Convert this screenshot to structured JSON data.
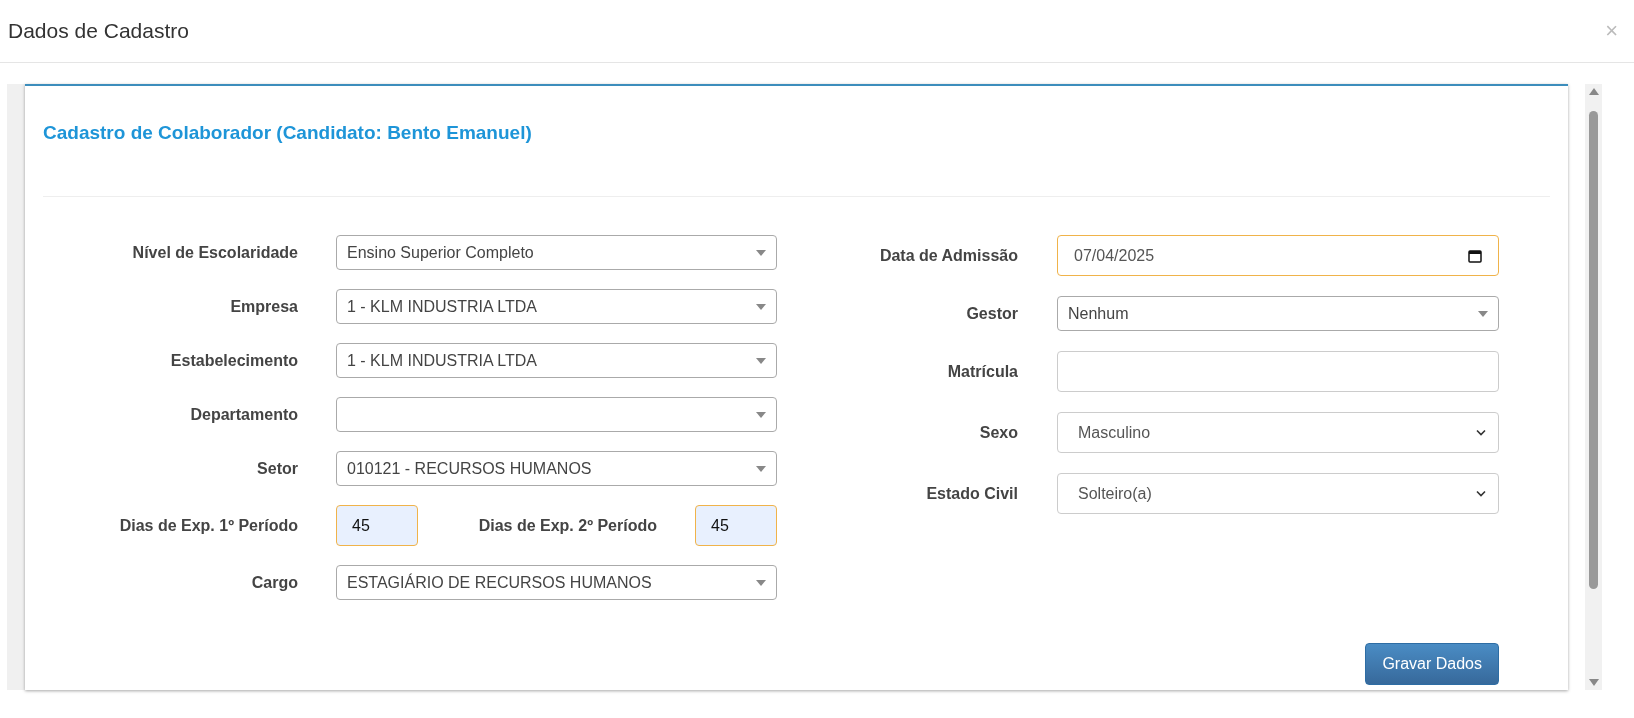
{
  "dialog": {
    "title": "Dados de Cadastro",
    "close": "×"
  },
  "form": {
    "title": "Cadastro de Colaborador (Candidato: Bento Emanuel)",
    "left_fields": [
      {
        "kind": "select",
        "label": "Nível de Escolaridade",
        "value": "Ensino Superior Completo"
      },
      {
        "kind": "select",
        "label": "Empresa",
        "value": "1 - KLM INDUSTRIA LTDA"
      },
      {
        "kind": "select",
        "label": "Estabelecimento",
        "value": "1 - KLM INDUSTRIA LTDA"
      },
      {
        "kind": "select",
        "label": "Departamento"
      },
      {
        "kind": "select",
        "label": "Setor",
        "value": "010121 - RECURSOS HUMANOS"
      },
      {
        "kind": "pair",
        "label": "Dias de Exp. 1º Período",
        "value": "45",
        "highlighted": true,
        "label_2": "Dias de Exp. 2º Período",
        "value_2": "45",
        "highlighted_2": true
      },
      {
        "kind": "select",
        "label": "Cargo",
        "value": "ESTAGIÁRIO DE RECURSOS HUMANOS"
      }
    ],
    "right_fields": [
      {
        "kind": "date",
        "label": "Data de Admissão",
        "value": "07/04/2025",
        "highlighted": true
      },
      {
        "kind": "select",
        "label": "Gestor",
        "value": "Nenhum"
      },
      {
        "kind": "text",
        "label": "Matrícula"
      },
      {
        "kind": "native",
        "label": "Sexo",
        "value": "Masculino"
      },
      {
        "kind": "native",
        "label": "Estado Civil",
        "value": "Solteiro(a)"
      }
    ],
    "save_button": "Gravar Dados"
  }
}
